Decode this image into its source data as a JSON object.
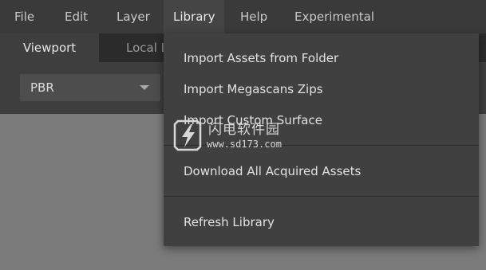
{
  "menubar": {
    "items": [
      "File",
      "Edit",
      "Layer",
      "Library",
      "Help",
      "Experimental"
    ],
    "active": "Library"
  },
  "tabs": [
    {
      "label": "Viewport"
    },
    {
      "label": "Local L"
    }
  ],
  "shader_select": {
    "value": "PBR"
  },
  "library_menu": {
    "groups": [
      [
        "Import Assets from Folder",
        "Import Megascans Zips",
        "Import Custom Surface"
      ],
      [
        "Download All Acquired Assets"
      ],
      [
        "Refresh Library"
      ]
    ]
  },
  "watermark": {
    "title": "闪电软件园",
    "url": "www.sd173.com"
  },
  "colors": {
    "menubar_bg": "#3a3a3a",
    "menu_active_bg": "#454545",
    "dropdown_bg": "#404040",
    "viewport_bg": "#7a7a7a"
  },
  "icons": [
    "chevron-down-icon",
    "lightning-logo-icon"
  ]
}
